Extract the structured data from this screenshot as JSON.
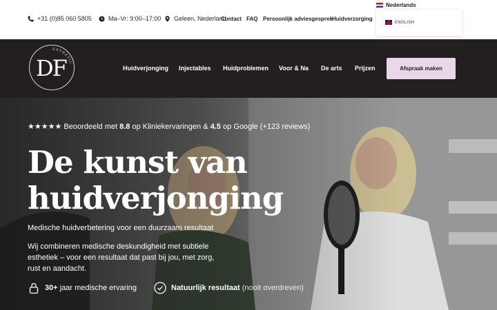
{
  "topbar": {
    "phone": "+31 (0)85 060 5805",
    "hours": "Ma–Vr: 9:00–17:00",
    "location": "Geleen, Nederland",
    "links": [
      "Contact",
      "FAQ",
      "Persoonlijk adviesgesprek",
      "Huidverzorging"
    ],
    "language_current": "Nederlands",
    "language_option": "ENGLISH"
  },
  "nav": {
    "logo_monogram": "DF",
    "logo_arc_text": "ESTHETIC CLINIC",
    "items": [
      "Huidverjonging",
      "Injectables",
      "Huidproblemen",
      "Voor & Na",
      "De arts",
      "Prijzen"
    ],
    "cta": "Afspraak maken"
  },
  "hero": {
    "rating_stars": "★★★★★",
    "rating_prefix": "Beoordeeld met",
    "rating_score_1": "8.8",
    "rating_mid": "op Kliniekervaringen &",
    "rating_score_2": "4.5",
    "rating_suffix": "op Google (+123 reviews)",
    "headline_line1": "De kunst van",
    "headline_line2": "huidverjonging",
    "subheadline": "Medische huidverbetering voor een duurzaam resultaat",
    "body": "Wij combineren medische deskundigheid met subtiele esthetiek – voor een resultaat dat past bij jou, met zorg, rust en aandacht.",
    "usp1_strong": "30+",
    "usp1_text": "jaar medische ervaring",
    "usp2_strong": "Natuurlijk resultaat",
    "usp2_text": "(nooit overdreven)"
  },
  "colors": {
    "nav_bg": "#231f20",
    "cta_bg": "#ead8ea",
    "text_dark": "#222222",
    "hero_text": "#ffffff"
  }
}
